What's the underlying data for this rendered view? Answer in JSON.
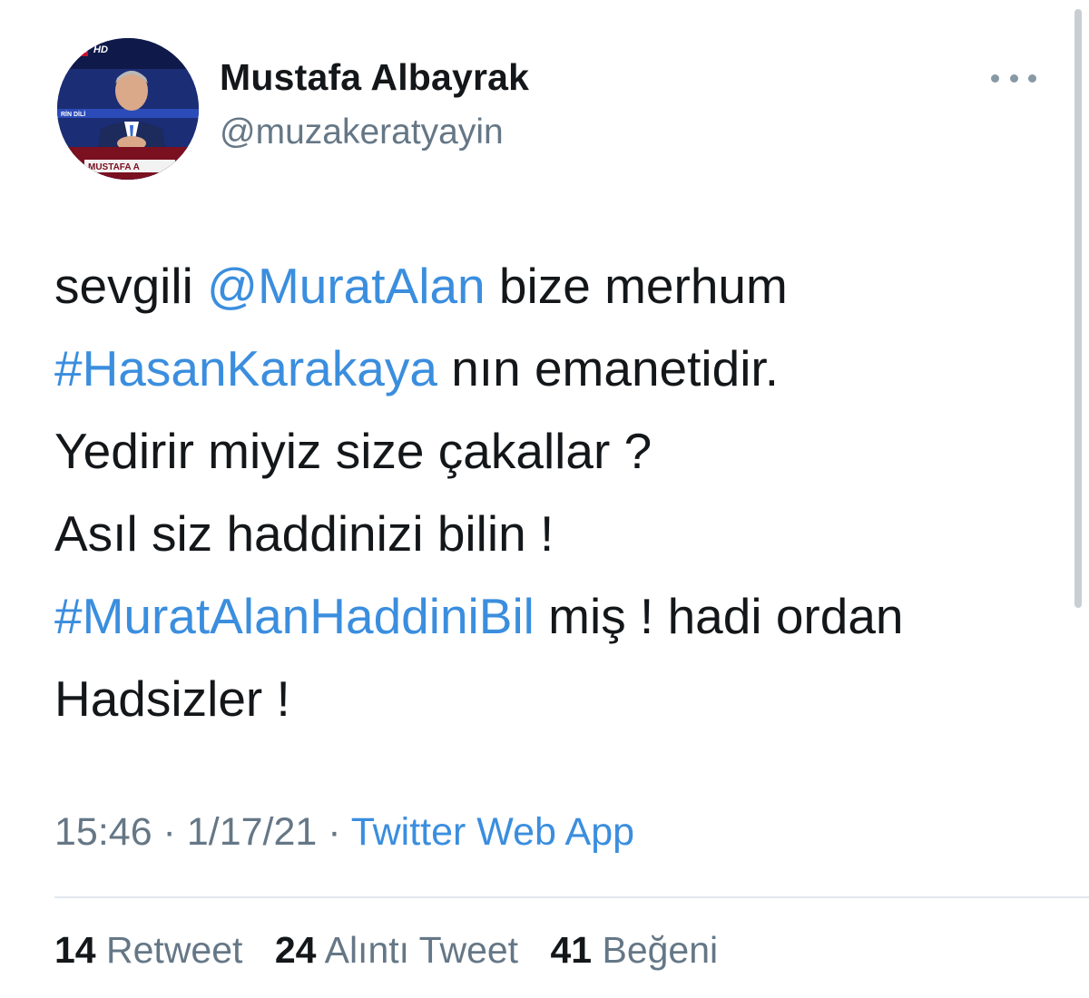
{
  "user": {
    "display_name": "Mustafa Albayrak",
    "handle": "@muzakeratyayin",
    "avatar_text": {
      "channel": "tv",
      "hd": "HD",
      "side_text": "RİN DİLİ",
      "name_tag": "MUSTAFA A"
    }
  },
  "more_icon": "more-horizontal-icon",
  "tweet": {
    "lines": [
      [
        {
          "text": "sevgili ",
          "type": "text"
        },
        {
          "text": "@MuratAlan",
          "type": "mention"
        },
        {
          "text": " bize merhum",
          "type": "text"
        }
      ],
      [
        {
          "text": "#HasanKarakaya",
          "type": "hashtag"
        },
        {
          "text": " nın emanetidir.",
          "type": "text"
        }
      ],
      [
        {
          "text": "Yedirir miyiz size çakallar ?",
          "type": "text"
        }
      ],
      [
        {
          "text": "Asıl siz haddinizi bilin !",
          "type": "text"
        }
      ],
      [
        {
          "text": "#MuratAlanHaddiniBil",
          "type": "hashtag"
        },
        {
          "text": " miş ! hadi ordan",
          "type": "text"
        }
      ],
      [
        {
          "text": "Hadsizler !",
          "type": "text"
        }
      ]
    ]
  },
  "meta": {
    "time": "15:46",
    "separator": " · ",
    "date": "1/17/21",
    "source": "Twitter Web App"
  },
  "stats": [
    {
      "count": "14",
      "label": "Retweet"
    },
    {
      "count": "24",
      "label": "Alıntı Tweet"
    },
    {
      "count": "41",
      "label": "Beğeni"
    }
  ],
  "colors": {
    "link": "#3b8ede",
    "text": "#14171a",
    "secondary": "#657786"
  }
}
